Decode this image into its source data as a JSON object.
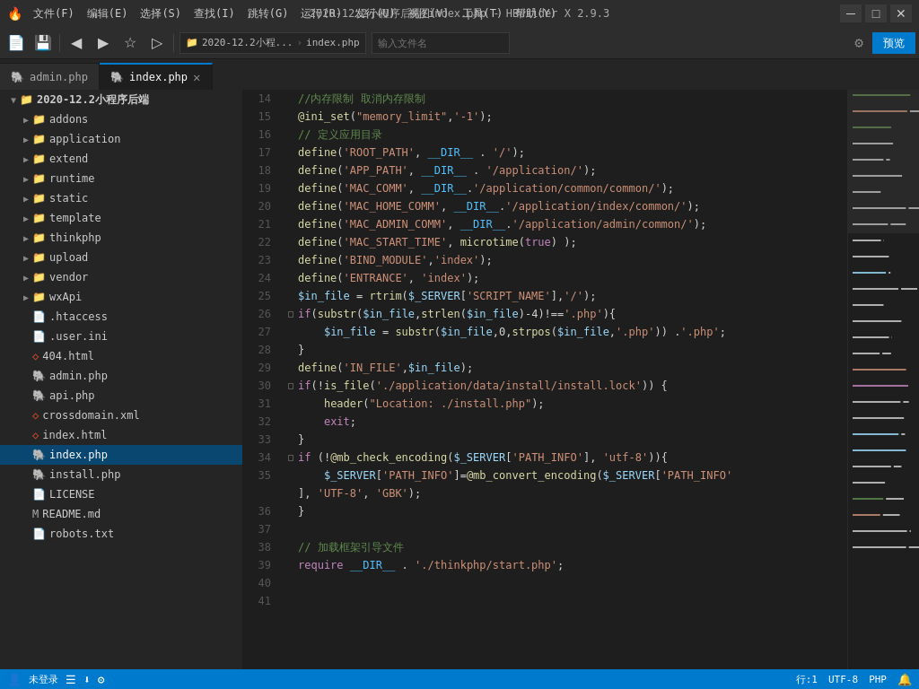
{
  "titlebar": {
    "icon": "🔥",
    "menus": [
      "文件(F)",
      "编辑(E)",
      "选择(S)",
      "查找(I)",
      "跳转(G)",
      "运行(R)",
      "发行(U)",
      "视图(V)",
      "工具(T)",
      "帮助(Y)"
    ],
    "title": "2020-12.2小程序后端/index.php - HBuilder X 2.9.3",
    "minimize": "─",
    "maximize": "□",
    "close": "✕"
  },
  "toolbar": {
    "buttons": [
      "💾",
      "📄",
      "◀",
      "▶",
      "☆",
      "▷"
    ],
    "breadcrumb1": "2020-12.2小程...",
    "breadcrumb2": "index.php",
    "search_placeholder": "输入文件名",
    "preview": "预览"
  },
  "tabs": [
    {
      "name": "admin.php",
      "active": false,
      "icon": "🐘"
    },
    {
      "name": "index.php",
      "active": true,
      "icon": "🐘"
    }
  ],
  "sidebar": {
    "root": "2020-12.2小程序后端",
    "items": [
      {
        "type": "folder",
        "name": "addons",
        "level": 1,
        "expanded": false
      },
      {
        "type": "folder",
        "name": "application",
        "level": 1,
        "expanded": false
      },
      {
        "type": "folder",
        "name": "extend",
        "level": 1,
        "expanded": false
      },
      {
        "type": "folder",
        "name": "runtime",
        "level": 1,
        "expanded": false
      },
      {
        "type": "folder",
        "name": "static",
        "level": 1,
        "expanded": false
      },
      {
        "type": "folder",
        "name": "template",
        "level": 1,
        "expanded": false
      },
      {
        "type": "folder",
        "name": "thinkphp",
        "level": 1,
        "expanded": false
      },
      {
        "type": "folder",
        "name": "upload",
        "level": 1,
        "expanded": false
      },
      {
        "type": "folder",
        "name": "vendor",
        "level": 1,
        "expanded": false
      },
      {
        "type": "folder",
        "name": "wxApi",
        "level": 1,
        "expanded": false
      },
      {
        "type": "file",
        "name": ".htaccess",
        "level": 1,
        "icon": "text"
      },
      {
        "type": "file",
        "name": ".user.ini",
        "level": 1,
        "icon": "ini"
      },
      {
        "type": "file",
        "name": "404.html",
        "level": 1,
        "icon": "html"
      },
      {
        "type": "file",
        "name": "admin.php",
        "level": 1,
        "icon": "php"
      },
      {
        "type": "file",
        "name": "api.php",
        "level": 1,
        "icon": "php"
      },
      {
        "type": "file",
        "name": "crossdomain.xml",
        "level": 1,
        "icon": "xml"
      },
      {
        "type": "file",
        "name": "index.html",
        "level": 1,
        "icon": "html"
      },
      {
        "type": "file",
        "name": "index.php",
        "level": 1,
        "icon": "php",
        "active": true
      },
      {
        "type": "file",
        "name": "install.php",
        "level": 1,
        "icon": "php"
      },
      {
        "type": "file",
        "name": "LICENSE",
        "level": 1,
        "icon": "text"
      },
      {
        "type": "file",
        "name": "README.md",
        "level": 1,
        "icon": "md"
      },
      {
        "type": "file",
        "name": "robots.txt",
        "level": 1,
        "icon": "text"
      }
    ]
  },
  "code": {
    "lines": [
      {
        "num": 14,
        "indicator": "",
        "content": "//内存限制 取消内存限制",
        "type": "comment"
      },
      {
        "num": 15,
        "indicator": "",
        "content": "@ini_set(\"memory_limit\",'-1');",
        "type": "code"
      },
      {
        "num": 16,
        "indicator": "",
        "content": "// 定义应用目录",
        "type": "comment"
      },
      {
        "num": 17,
        "indicator": "",
        "content": "define('ROOT_PATH', __DIR__ . '/');",
        "type": "code"
      },
      {
        "num": 18,
        "indicator": "",
        "content": "define('APP_PATH', __DIR__ . '/application/');",
        "type": "code"
      },
      {
        "num": 19,
        "indicator": "",
        "content": "define('MAC_COMM', __DIR__.'./application/common/common/');",
        "type": "code"
      },
      {
        "num": 20,
        "indicator": "",
        "content": "define('MAC_HOME_COMM', __DIR__.'./application/index/common/');",
        "type": "code"
      },
      {
        "num": 21,
        "indicator": "",
        "content": "define('MAC_ADMIN_COMM', __DIR__.'./application/admin/common/');",
        "type": "code"
      },
      {
        "num": 22,
        "indicator": "",
        "content": "define('MAC_START_TIME', microtime(true) );",
        "type": "code"
      },
      {
        "num": 23,
        "indicator": "",
        "content": "define('BIND_MODULE','index');",
        "type": "code"
      },
      {
        "num": 24,
        "indicator": "",
        "content": "define('ENTRANCE', 'index');",
        "type": "code"
      },
      {
        "num": 25,
        "indicator": "",
        "content": "$in_file = rtrim($_SERVER['SCRIPT_NAME'],'/');",
        "type": "code"
      },
      {
        "num": 26,
        "indicator": "□",
        "content": "if(substr($in_file,strlen($in_file)-4)!=='.php'){",
        "type": "code"
      },
      {
        "num": 27,
        "indicator": "",
        "content": "    $in_file = substr($in_file,0,strpos($in_file,'.php')) .'.php';",
        "type": "code"
      },
      {
        "num": 28,
        "indicator": "",
        "content": "}",
        "type": "code"
      },
      {
        "num": 29,
        "indicator": "",
        "content": "define('IN_FILE',$in_file);",
        "type": "code"
      },
      {
        "num": 30,
        "indicator": "□",
        "content": "if(!is_file('./application/data/install/install.lock')) {",
        "type": "code"
      },
      {
        "num": 31,
        "indicator": "",
        "content": "    header(\"Location: ./install.php\");",
        "type": "code"
      },
      {
        "num": 32,
        "indicator": "",
        "content": "    exit;",
        "type": "code"
      },
      {
        "num": 33,
        "indicator": "",
        "content": "}",
        "type": "code"
      },
      {
        "num": 34,
        "indicator": "□",
        "content": "if (!@mb_check_encoding($_SERVER['PATH_INFO'], 'utf-8')){",
        "type": "code"
      },
      {
        "num": 35,
        "indicator": "",
        "content": "    $_SERVER['PATH_INFO']=@mb_convert_encoding($_SERVER['PATH_INFO'",
        "type": "code"
      },
      {
        "num": 35.1,
        "indicator": "",
        "content": "], 'UTF-8', 'GBK');",
        "type": "code"
      },
      {
        "num": 36,
        "indicator": "",
        "content": "}",
        "type": "code"
      },
      {
        "num": 37,
        "indicator": "",
        "content": "",
        "type": "empty"
      },
      {
        "num": 38,
        "indicator": "",
        "content": "// 加载框架引导文件",
        "type": "comment"
      },
      {
        "num": 39,
        "indicator": "",
        "content": "require __DIR__ . './thinkphp/start.php';",
        "type": "code"
      },
      {
        "num": 40,
        "indicator": "",
        "content": "",
        "type": "empty"
      },
      {
        "num": 41,
        "indicator": "",
        "content": "",
        "type": "empty"
      }
    ]
  },
  "statusbar": {
    "user": "未登录",
    "row": "行:1",
    "encoding": "UTF-8",
    "language": "PHP"
  }
}
